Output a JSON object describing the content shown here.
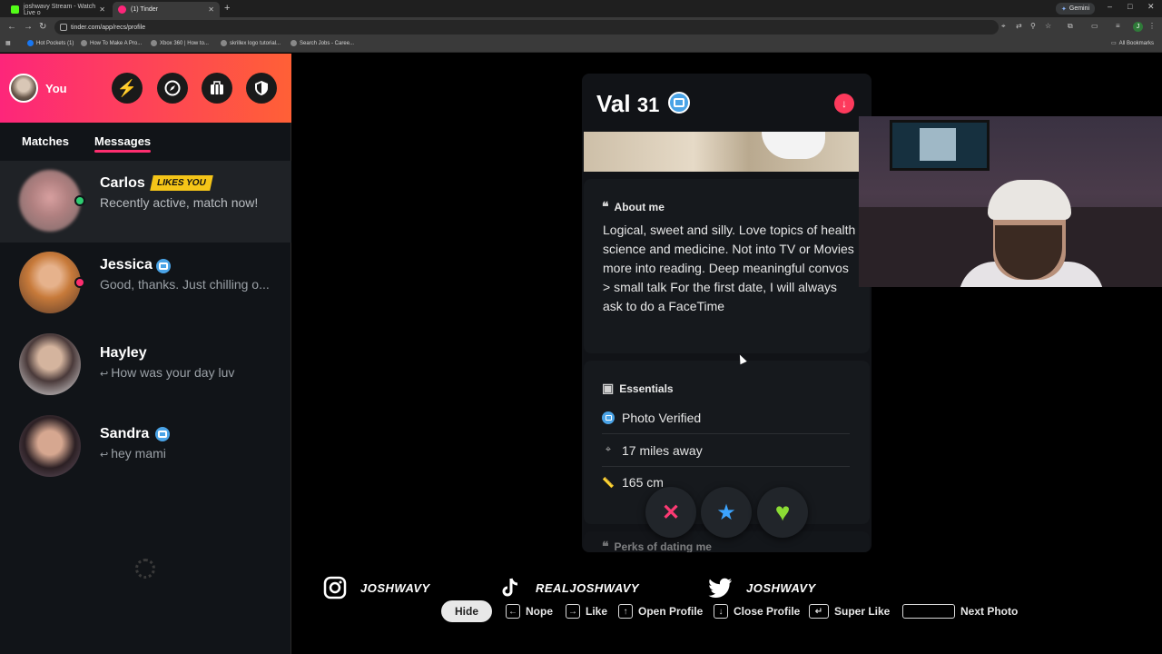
{
  "browser": {
    "tabs": [
      {
        "title": "joshwavy Stream - Watch Live o",
        "favicon_color": "#53fc18"
      },
      {
        "title": "(1) Tinder",
        "favicon_color": "#fd267a"
      }
    ],
    "gemini_label": "Gemini",
    "url": "tinder.com/app/recs/profile",
    "account_initial": "J",
    "bookmarks": [
      "Hot Pockets (1)",
      "How To Make A Pro...",
      "Xbox 360 | How to...",
      "skrillex logo tutorial...",
      "Search Jobs - Caree..."
    ],
    "all_bookmarks": "All Bookmarks"
  },
  "sidebar": {
    "profile_label": "You",
    "tabs": [
      "Matches",
      "Messages"
    ],
    "active_tab": "Messages",
    "messages": [
      {
        "name": "Carlos",
        "badge": "LIKES YOU",
        "preview": "Recently active, match now!",
        "online": true,
        "verified": false,
        "replied": false
      },
      {
        "name": "Jessica",
        "preview": "Good, thanks. Just chilling o...",
        "online": true,
        "verified": true,
        "replied": false
      },
      {
        "name": "Hayley",
        "preview": "How was your day luv",
        "online": false,
        "verified": false,
        "replied": true
      },
      {
        "name": "Sandra",
        "preview": "hey mami",
        "online": false,
        "verified": true,
        "replied": true
      }
    ]
  },
  "profile": {
    "name": "Val",
    "age": "31",
    "about_heading": "About me",
    "about_text": "Logical, sweet and silly. Love topics of health science and medicine. Not into TV or Movies more into reading. Deep meaningful convos > small talk For the first date, I will always ask to do a FaceTime",
    "essentials_heading": "Essentials",
    "essentials": [
      "Photo Verified",
      "17 miles away",
      "165 cm"
    ],
    "next_section_heading": "Perks of dating me"
  },
  "actions": {
    "nope": "✕",
    "super_like": "★",
    "like": "♥"
  },
  "overlay": {
    "socials": [
      {
        "platform": "instagram",
        "handle": "JOSHWAVY"
      },
      {
        "platform": "tiktok",
        "handle": "REALJOSHWAVY"
      },
      {
        "platform": "twitter",
        "handle": "JOSHWAVY"
      }
    ],
    "hide_label": "Hide",
    "shortcuts": [
      {
        "key": "←",
        "label": "Nope"
      },
      {
        "key": "→",
        "label": "Like"
      },
      {
        "key": "↑",
        "label": "Open Profile"
      },
      {
        "key": "↓",
        "label": "Close Profile"
      },
      {
        "key": "↵",
        "label": "Super Like"
      },
      {
        "key": "space",
        "label": "Next Photo"
      }
    ]
  },
  "colors": {
    "brand_gradient_start": "#fd267a",
    "brand_gradient_end": "#ff6036",
    "verified_blue": "#4aa3e6",
    "likes_you_gold": "#f5c518",
    "online_green": "#2ecc71"
  }
}
